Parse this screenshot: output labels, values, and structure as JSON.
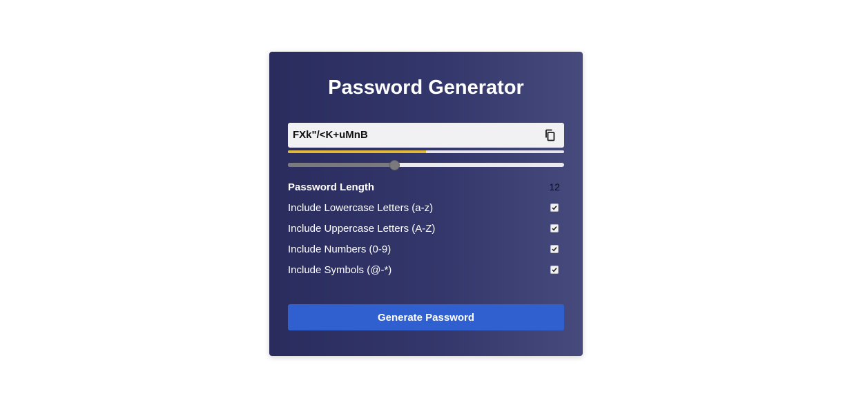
{
  "app": {
    "title": "Password Generator"
  },
  "password": {
    "value": "FXk\"/<K+uMnB",
    "copy_icon": "copy-icon",
    "strength_fraction": 0.5
  },
  "length_slider": {
    "value": 12,
    "min": 4,
    "max": 32,
    "fill_fraction": 0.385
  },
  "settings": {
    "length_label": "Password Length",
    "length_value": "12",
    "options": [
      {
        "label": "Include Lowercase Letters (a-z)",
        "checked": true
      },
      {
        "label": "Include Uppercase Letters (A-Z)",
        "checked": true
      },
      {
        "label": "Include Numbers (0-9)",
        "checked": true
      },
      {
        "label": "Include Symbols (@-*)",
        "checked": true
      }
    ]
  },
  "actions": {
    "generate_label": "Generate Password"
  },
  "colors": {
    "card_gradient_start": "#2a2c5e",
    "card_gradient_end": "#474a7c",
    "strength": "#e0b93a",
    "button": "#3060cf"
  }
}
